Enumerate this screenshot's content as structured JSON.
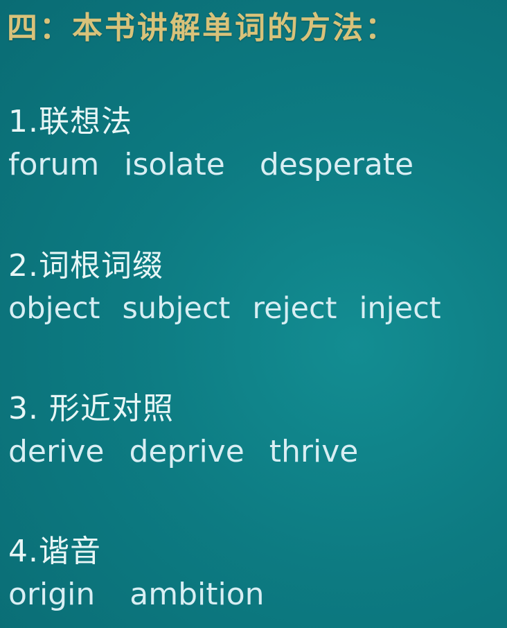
{
  "title": "四：本书讲解单词的方法：",
  "sections": [
    {
      "heading": "1.联想法",
      "words": [
        "forum",
        "isolate",
        "desperate"
      ]
    },
    {
      "heading": "2.词根词缀",
      "words": [
        "object",
        "subject",
        "reject",
        "inject"
      ]
    },
    {
      "heading": "3. 形近对照",
      "words": [
        "derive",
        "deprive",
        "thrive"
      ]
    },
    {
      "heading": "4.谐音",
      "words": [
        "origin",
        "ambition"
      ]
    }
  ],
  "colors": {
    "background": "#0f7f86",
    "title": "#d8c27a",
    "text": "#e8f6f6"
  }
}
